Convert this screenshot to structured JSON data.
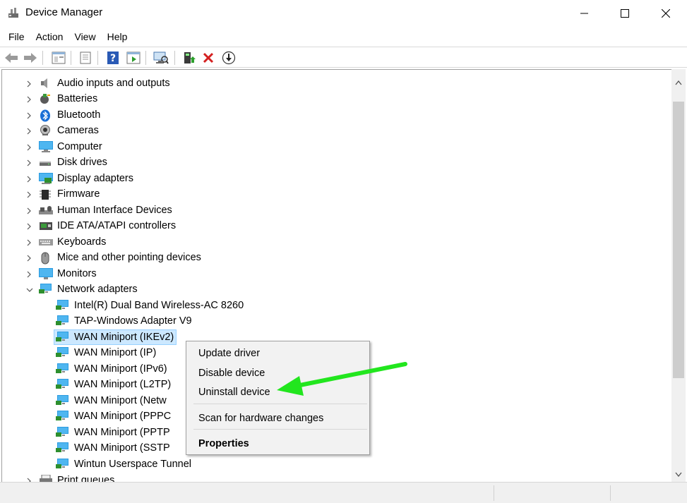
{
  "window": {
    "title": "Device Manager",
    "app_icon": "device-manager-icon",
    "controls": [
      "minimize-icon",
      "maximize-icon",
      "close-icon"
    ]
  },
  "menu": {
    "items": [
      {
        "label": "File"
      },
      {
        "label": "Action"
      },
      {
        "label": "View"
      },
      {
        "label": "Help"
      }
    ]
  },
  "toolbar": {
    "buttons": [
      "back-arrow-icon",
      "forward-arrow-icon",
      "properties-pane-icon",
      "properties-icon",
      "help-icon",
      "run-icon",
      "scan-hardware-icon",
      "update-driver-icon",
      "uninstall-icon",
      "download-icon"
    ]
  },
  "tree": {
    "categories": [
      {
        "label": "Audio inputs and outputs",
        "icon": "speaker-icon"
      },
      {
        "label": "Batteries",
        "icon": "battery-icon"
      },
      {
        "label": "Bluetooth",
        "icon": "bluetooth-icon"
      },
      {
        "label": "Cameras",
        "icon": "camera-icon"
      },
      {
        "label": "Computer",
        "icon": "computer-icon"
      },
      {
        "label": "Disk drives",
        "icon": "disk-drive-icon"
      },
      {
        "label": "Display adapters",
        "icon": "display-adapter-icon"
      },
      {
        "label": "Firmware",
        "icon": "firmware-icon"
      },
      {
        "label": "Human Interface Devices",
        "icon": "hid-icon"
      },
      {
        "label": "IDE ATA/ATAPI controllers",
        "icon": "ide-controller-icon"
      },
      {
        "label": "Keyboards",
        "icon": "keyboard-icon"
      },
      {
        "label": "Mice and other pointing devices",
        "icon": "mouse-icon"
      },
      {
        "label": "Monitors",
        "icon": "monitor-icon"
      },
      {
        "label": "Network adapters",
        "icon": "network-adapter-icon",
        "expanded": true
      }
    ],
    "network_children": [
      {
        "label": "Intel(R) Dual Band Wireless-AC 8260"
      },
      {
        "label": "TAP-Windows Adapter V9"
      },
      {
        "label": "WAN Miniport (IKEv2)",
        "selected": true
      },
      {
        "label": "WAN Miniport (IP)"
      },
      {
        "label": "WAN Miniport (IPv6)"
      },
      {
        "label": "WAN Miniport (L2TP)"
      },
      {
        "label": "WAN Miniport (Netw"
      },
      {
        "label": "WAN Miniport (PPPC"
      },
      {
        "label": "WAN Miniport (PPTP"
      },
      {
        "label": "WAN Miniport (SSTP"
      },
      {
        "label": "Wintun Userspace Tunnel"
      }
    ],
    "after": {
      "label": "Print queues",
      "icon": "printer-icon"
    }
  },
  "context_menu": {
    "items": [
      {
        "label": "Update driver"
      },
      {
        "label": "Disable device"
      },
      {
        "label": "Uninstall device"
      },
      {
        "label": "Scan for hardware changes"
      },
      {
        "label": "Properties",
        "bold": true
      }
    ]
  },
  "annotation": {
    "color": "#22e61e",
    "points_to": "Uninstall device"
  },
  "colors": {
    "selection": "#cce8ff",
    "selection_border": "#99d1ff",
    "menu_bg": "#f2f2f2"
  }
}
